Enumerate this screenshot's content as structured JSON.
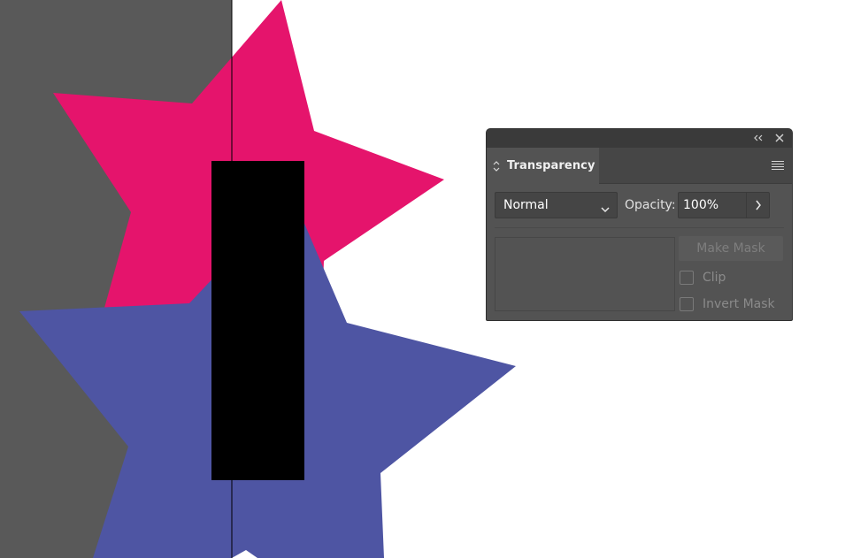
{
  "colors": {
    "canvas_gray": "#595959",
    "star_magenta": "#E5146C",
    "star_blue": "#4E55A3",
    "rect_black": "#000000",
    "panel_bg": "#535353",
    "panel_title_bg": "#3a3a3a"
  },
  "transparency_panel": {
    "tab_label": "Transparency",
    "blend_mode": {
      "selected": "Normal"
    },
    "opacity": {
      "label": "Opacity:",
      "value": "100%"
    },
    "make_mask_label": "Make Mask",
    "clip_label": "Clip",
    "invert_mask_label": "Invert Mask",
    "clip_checked": false,
    "invert_mask_checked": false,
    "icons": {
      "collapse": "double-chevron-left-icon",
      "close": "close-icon",
      "tab_arrows": "up-down-arrows-icon",
      "menu": "hamburger-menu-icon",
      "select_chevron": "chevron-down-icon",
      "stepper": "chevron-right-icon"
    }
  }
}
